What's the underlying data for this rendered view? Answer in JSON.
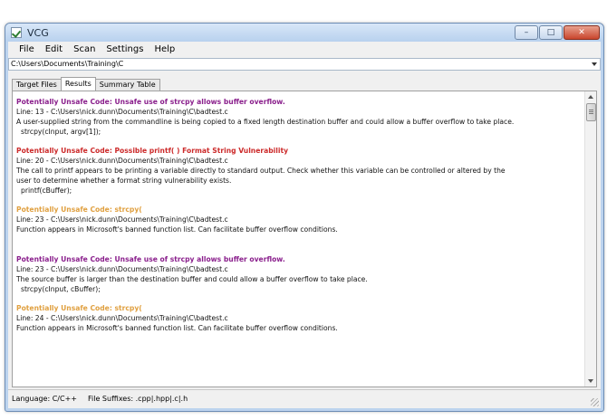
{
  "window": {
    "title": "VCG",
    "controls": {
      "minimize": "–",
      "maximize": "□",
      "close": "✕"
    }
  },
  "menu": [
    "File",
    "Edit",
    "Scan",
    "Settings",
    "Help"
  ],
  "path": {
    "value": "C:\\Users\\Documents\\Training\\C"
  },
  "tabs": [
    {
      "label": "Target Files",
      "active": false
    },
    {
      "label": "Results",
      "active": true
    },
    {
      "label": "Summary Table",
      "active": false
    }
  ],
  "colors": {
    "warning_purple": "#8a1f8c",
    "warning_red": "#cc2a2a",
    "warning_orange": "#e0a040"
  },
  "results": [
    {
      "heading": "Potentially Unsafe Code: Unsafe use of strcpy allows buffer overflow.",
      "color": "#8a1f8c",
      "lines": [
        "Line: 13 - C:\\Users\\nick.dunn\\Documents\\Training\\C\\badtest.c",
        "A user-supplied string from the commandline is being copied to a fixed length destination buffer and could allow a buffer overflow to take place."
      ],
      "code": [
        "strcpy(cInput, argv[1]);"
      ],
      "gap": false
    },
    {
      "heading": "Potentially Unsafe Code: Possible printf( ) Format String Vulnerability",
      "color": "#cc2a2a",
      "lines": [
        "Line: 20 - C:\\Users\\nick.dunn\\Documents\\Training\\C\\badtest.c",
        "The call to printf appears to be printing a variable directly to standard output. Check whether this variable can be controlled or altered by the",
        "user to determine whether a format string vulnerability exists."
      ],
      "code": [
        "printf(cBuffer);"
      ],
      "gap": false
    },
    {
      "heading": "Potentially Unsafe Code: strcpy(",
      "color": "#e0a040",
      "lines": [
        "Line: 23 - C:\\Users\\nick.dunn\\Documents\\Training\\C\\badtest.c",
        "Function appears in Microsoft's banned function list. Can facilitate buffer overflow conditions."
      ],
      "code": [],
      "gap": true
    },
    {
      "heading": "Potentially Unsafe Code: Unsafe use of strcpy allows buffer overflow.",
      "color": "#8a1f8c",
      "lines": [
        "Line: 23 - C:\\Users\\nick.dunn\\Documents\\Training\\C\\badtest.c",
        "The source buffer is larger than the destination buffer and could allow a buffer overflow to take place."
      ],
      "code": [
        "strcpy(cInput, cBuffer);"
      ],
      "gap": false
    },
    {
      "heading": "Potentially Unsafe Code: strcpy(",
      "color": "#e0a040",
      "lines": [
        "Line: 24 - C:\\Users\\nick.dunn\\Documents\\Training\\C\\badtest.c",
        "Function appears in Microsoft's banned function list. Can facilitate buffer overflow conditions."
      ],
      "code": [],
      "gap": false
    }
  ],
  "status": {
    "language": "Language: C/C++",
    "suffixes": "File Suffixes: .cpp|.hpp|.c|.h"
  }
}
